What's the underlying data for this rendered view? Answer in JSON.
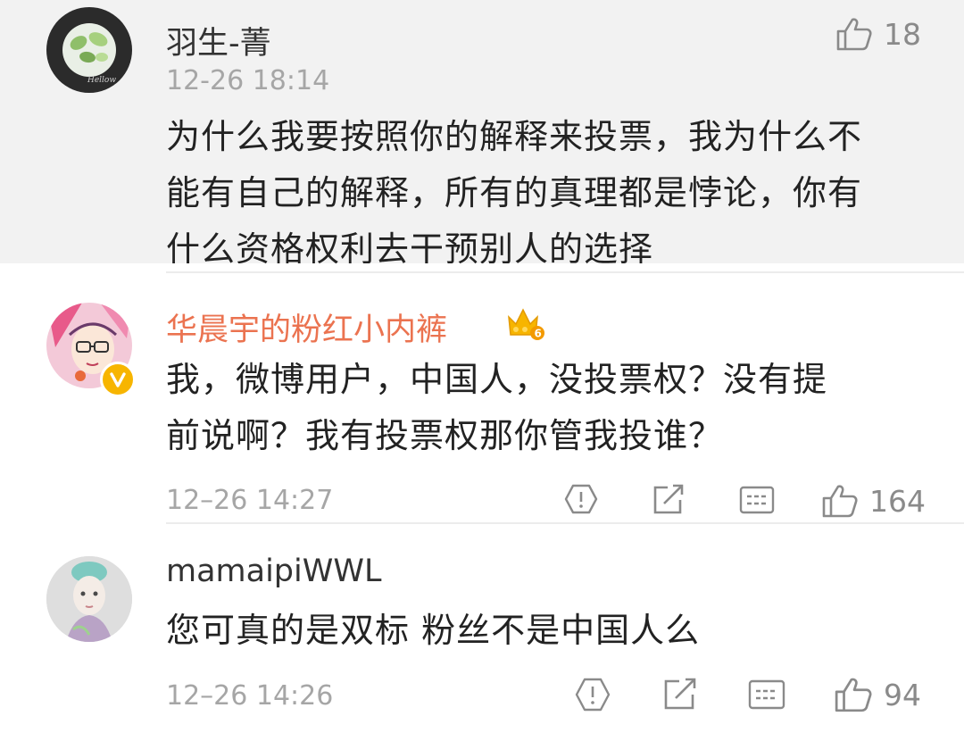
{
  "comments": [
    {
      "username": "羽生-菁",
      "time": "12-26 18:14",
      "likes": "18",
      "avatar_icon": "leaf-photo-avatar",
      "text_lines": [
        "为什么我要按照你的解释来投票，我为什么不",
        "能有自己的解释，所有的真理都是悖论，你有",
        "什么资格权利去干预别人的选择"
      ]
    },
    {
      "username": "华晨宇的粉红小内裤",
      "time": "12–26 14:27",
      "likes": "164",
      "avatar_icon": "drawn-girl-glasses-avatar",
      "vip_badge": "crown-6-icon",
      "verified_badge": "verified-v-icon",
      "text_lines": [
        "我，微博用户，中国人，没投票权？没有提",
        "前说啊？我有投票权那你管我投谁？"
      ]
    },
    {
      "username": "mamaipiWWL",
      "time": "12–26 14:26",
      "likes": "94",
      "avatar_icon": "child-portrait-avatar",
      "text_lines": [
        "您可真的是双标 粉丝不是中国人么"
      ]
    }
  ],
  "colors": {
    "highlight_bg": "#f2f2f2",
    "vip_name": "#eb7350",
    "badge": "#f7b500"
  }
}
